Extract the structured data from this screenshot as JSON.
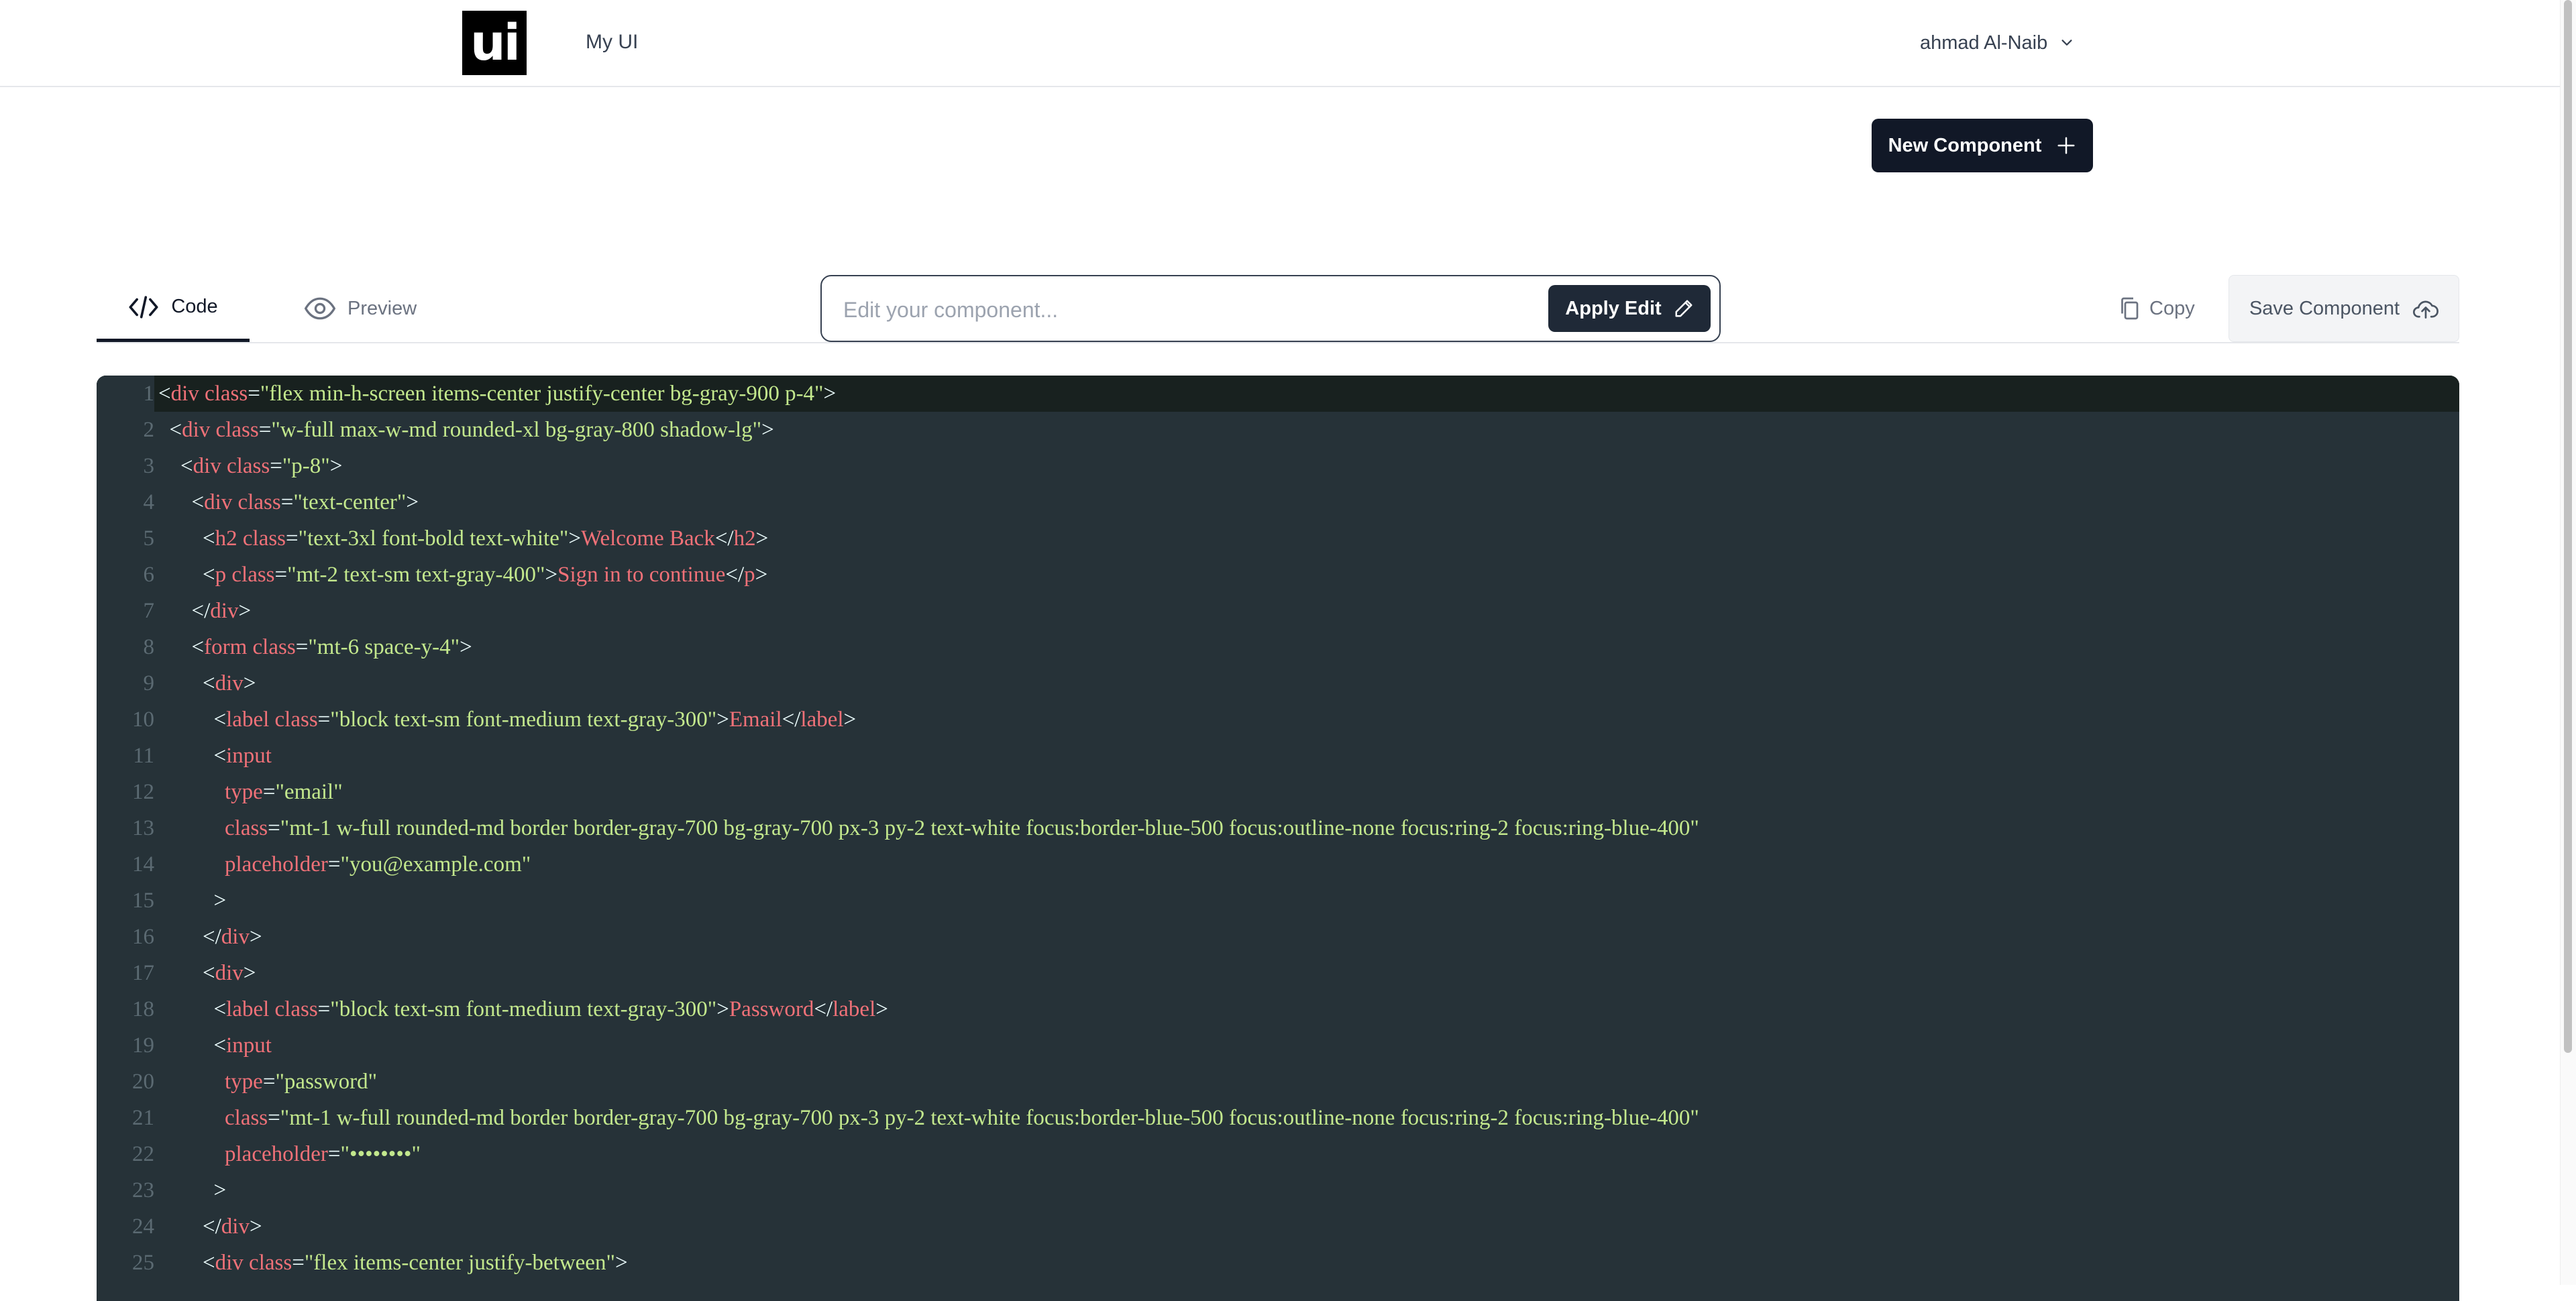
{
  "header": {
    "logo_text": "ui",
    "app_name": "My UI",
    "user_name": "ahmad Al-Naib"
  },
  "actions": {
    "new_component": "New Component"
  },
  "tabs": [
    {
      "label": "Code",
      "selected": true
    },
    {
      "label": "Preview",
      "selected": false
    }
  ],
  "edit": {
    "placeholder": "Edit your component...",
    "apply_label": "Apply Edit"
  },
  "toolbar": {
    "copy_label": "Copy",
    "save_label": "Save Component"
  },
  "editor": {
    "active_line": 1,
    "lines": [
      [
        [
          "p",
          "<"
        ],
        [
          "t",
          "div"
        ],
        [
          "a",
          " class"
        ],
        [
          "p",
          "="
        ],
        [
          "s",
          "\"flex min-h-screen items-center justify-center bg-gray-900 p-4\""
        ],
        [
          "p",
          ">"
        ]
      ],
      [
        [
          "p",
          "  <"
        ],
        [
          "t",
          "div"
        ],
        [
          "a",
          " class"
        ],
        [
          "p",
          "="
        ],
        [
          "s",
          "\"w-full max-w-md rounded-xl bg-gray-800 shadow-lg\""
        ],
        [
          "p",
          ">"
        ]
      ],
      [
        [
          "p",
          "    <"
        ],
        [
          "t",
          "div"
        ],
        [
          "a",
          " class"
        ],
        [
          "p",
          "="
        ],
        [
          "s",
          "\"p-8\""
        ],
        [
          "p",
          ">"
        ]
      ],
      [
        [
          "p",
          "      <"
        ],
        [
          "t",
          "div"
        ],
        [
          "a",
          " class"
        ],
        [
          "p",
          "="
        ],
        [
          "s",
          "\"text-center\""
        ],
        [
          "p",
          ">"
        ]
      ],
      [
        [
          "p",
          "        <"
        ],
        [
          "t",
          "h2"
        ],
        [
          "a",
          " class"
        ],
        [
          "p",
          "="
        ],
        [
          "s",
          "\"text-3xl font-bold text-white\""
        ],
        [
          "p",
          ">"
        ],
        [
          "x",
          "Welcome Back"
        ],
        [
          "p",
          "</"
        ],
        [
          "t",
          "h2"
        ],
        [
          "p",
          ">"
        ]
      ],
      [
        [
          "p",
          "        <"
        ],
        [
          "t",
          "p"
        ],
        [
          "a",
          " class"
        ],
        [
          "p",
          "="
        ],
        [
          "s",
          "\"mt-2 text-sm text-gray-400\""
        ],
        [
          "p",
          ">"
        ],
        [
          "x",
          "Sign in to continue"
        ],
        [
          "p",
          "</"
        ],
        [
          "t",
          "p"
        ],
        [
          "p",
          ">"
        ]
      ],
      [
        [
          "p",
          "      </"
        ],
        [
          "t",
          "div"
        ],
        [
          "p",
          ">"
        ]
      ],
      [
        [
          "p",
          "      <"
        ],
        [
          "t",
          "form"
        ],
        [
          "a",
          " class"
        ],
        [
          "p",
          "="
        ],
        [
          "s",
          "\"mt-6 space-y-4\""
        ],
        [
          "p",
          ">"
        ]
      ],
      [
        [
          "p",
          "        <"
        ],
        [
          "t",
          "div"
        ],
        [
          "p",
          ">"
        ]
      ],
      [
        [
          "p",
          "          <"
        ],
        [
          "t",
          "label"
        ],
        [
          "a",
          " class"
        ],
        [
          "p",
          "="
        ],
        [
          "s",
          "\"block text-sm font-medium text-gray-300\""
        ],
        [
          "p",
          ">"
        ],
        [
          "x",
          "Email"
        ],
        [
          "p",
          "</"
        ],
        [
          "t",
          "label"
        ],
        [
          "p",
          ">"
        ]
      ],
      [
        [
          "p",
          "          <"
        ],
        [
          "t",
          "input"
        ]
      ],
      [
        [
          "a",
          "            type"
        ],
        [
          "p",
          "="
        ],
        [
          "s",
          "\"email\""
        ]
      ],
      [
        [
          "a",
          "            class"
        ],
        [
          "p",
          "="
        ],
        [
          "s",
          "\"mt-1 w-full rounded-md border border-gray-700 bg-gray-700 px-3 py-2 text-white focus:border-blue-500 focus:outline-none focus:ring-2 focus:ring-blue-400\""
        ]
      ],
      [
        [
          "a",
          "            placeholder"
        ],
        [
          "p",
          "="
        ],
        [
          "s",
          "\"you@example.com\""
        ]
      ],
      [
        [
          "p",
          "          >"
        ]
      ],
      [
        [
          "p",
          "        </"
        ],
        [
          "t",
          "div"
        ],
        [
          "p",
          ">"
        ]
      ],
      [
        [
          "p",
          "        <"
        ],
        [
          "t",
          "div"
        ],
        [
          "p",
          ">"
        ]
      ],
      [
        [
          "p",
          "          <"
        ],
        [
          "t",
          "label"
        ],
        [
          "a",
          " class"
        ],
        [
          "p",
          "="
        ],
        [
          "s",
          "\"block text-sm font-medium text-gray-300\""
        ],
        [
          "p",
          ">"
        ],
        [
          "x",
          "Password"
        ],
        [
          "p",
          "</"
        ],
        [
          "t",
          "label"
        ],
        [
          "p",
          ">"
        ]
      ],
      [
        [
          "p",
          "          <"
        ],
        [
          "t",
          "input"
        ]
      ],
      [
        [
          "a",
          "            type"
        ],
        [
          "p",
          "="
        ],
        [
          "s",
          "\"password\""
        ]
      ],
      [
        [
          "a",
          "            class"
        ],
        [
          "p",
          "="
        ],
        [
          "s",
          "\"mt-1 w-full rounded-md border border-gray-700 bg-gray-700 px-3 py-2 text-white focus:border-blue-500 focus:outline-none focus:ring-2 focus:ring-blue-400\""
        ]
      ],
      [
        [
          "a",
          "            placeholder"
        ],
        [
          "p",
          "="
        ],
        [
          "s",
          "\"••••••••\""
        ]
      ],
      [
        [
          "p",
          "          >"
        ]
      ],
      [
        [
          "p",
          "        </"
        ],
        [
          "t",
          "div"
        ],
        [
          "p",
          ">"
        ]
      ],
      [
        [
          "p",
          "        <"
        ],
        [
          "t",
          "div"
        ],
        [
          "a",
          " class"
        ],
        [
          "p",
          "="
        ],
        [
          "s",
          "\"flex items-center justify-between\""
        ],
        [
          "p",
          ">"
        ]
      ]
    ]
  },
  "colors": {
    "editor_bg": "#263238",
    "string": "#c3e88d",
    "tag": "#f07178",
    "punctuation": "#eeffff",
    "line_number": "#5b6a72",
    "primary_button": "#111827"
  }
}
